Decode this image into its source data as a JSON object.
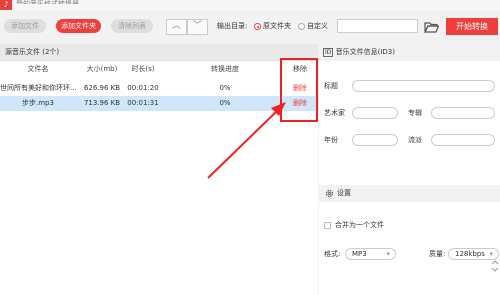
{
  "app": {
    "title": "我的音乐格式转换器"
  },
  "toolbar": {
    "add_file": "添加文件",
    "add_folder": "添加文件夹",
    "clear_list": "清除列表",
    "output_dir_label": "输出目录:",
    "option_source": "原文件夹",
    "option_custom": "自定义",
    "path_value": "",
    "start_label": "开始转换"
  },
  "file_panel": {
    "header": "源音乐文件 (2个)",
    "columns": [
      "文件名",
      "大小(mb)",
      "时长(s)",
      "转换进度",
      "移除"
    ],
    "rows": [
      {
        "name": "世间所有美好和你环环...",
        "size": "626.96 KB",
        "duration": "00:01:20",
        "progress": "0%",
        "remove": "删除"
      },
      {
        "name": "步步.mp3",
        "size": "713.96 KB",
        "duration": "00:01:31",
        "progress": "0%",
        "remove": "删除"
      }
    ],
    "selected_row": 1
  },
  "info_panel": {
    "header": "音乐文件信息(ID3)",
    "title_label": "标题",
    "artist_label": "艺术家",
    "album_label": "专辑",
    "year_label": "年份",
    "genre_label": "流派",
    "id_badge": "ID"
  },
  "settings": {
    "header": "设置",
    "merge_label": "合并为一个文件",
    "format_label": "格式:",
    "format_value": "MP3",
    "quality_label": "质量:",
    "quality_value": "128kbps"
  },
  "colors": {
    "accent": "#ef3f3c",
    "selected_row": "#cfe6fb",
    "annotation": "#e22"
  }
}
